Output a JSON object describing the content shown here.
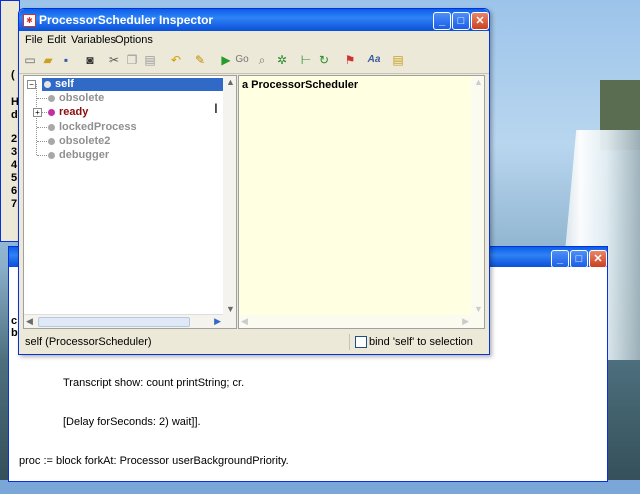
{
  "inspector": {
    "title": "ProcessorScheduler Inspector",
    "menu": [
      "File",
      "Edit",
      "Variables",
      "Options"
    ],
    "tree": {
      "root": "self",
      "children": [
        "obsolete",
        "ready",
        "lockedProcess",
        "obsolete2",
        "debugger"
      ]
    },
    "value_text": "a ProcessorScheduler",
    "status_text": "self (ProcessorScheduler)",
    "bind_label": "bind 'self' to selection"
  },
  "toolbar_icons": [
    "new-icon",
    "open-icon",
    "save-icon",
    "camera-icon",
    "cut-icon",
    "copy-icon",
    "paste-icon",
    "undo-icon",
    "pencil-icon",
    "run-icon",
    "goto-icon",
    "search-icon",
    "bug-icon",
    "tree-icon",
    "refresh-icon",
    "flag-icon",
    "font-icon",
    "note-icon"
  ],
  "workspace": {
    "code_lines": [
      "Transcript show: count printString; cr.",
      "[Delay forSeconds: 2) wait]].",
      "proc := block forkAt: Processor userBackgroundPriority."
    ],
    "side_chars": [
      "(",
      "H",
      "d",
      "2",
      "3",
      "4",
      "5",
      "6",
      "7",
      "c",
      "b"
    ]
  },
  "colors": {
    "titlebar": "#0a5fe8",
    "value_bg": "#ffffe1",
    "selection": "#3169c6"
  }
}
